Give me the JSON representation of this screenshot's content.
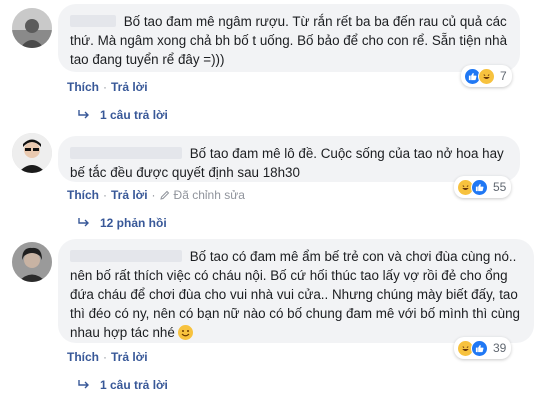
{
  "colors": {
    "link": "#385898",
    "bubble": "#f2f3f5",
    "meta": "#90949c",
    "like": "#2078f4",
    "haha": "#f7c23e"
  },
  "comments": [
    {
      "text": "Bố tao đam mê ngâm rượu. Từ rắn rết ba ba đến rau củ quả các thứ. Mà ngâm xong chả bh bố t uống. Bố bảo để cho con rể. Sẵn tiện nhà tao đang tuyển rể đây =)))",
      "reactions": [
        "like-icon",
        "haha-icon"
      ],
      "reaction_count": "7",
      "like_label": "Thích",
      "reply_label": "Trả lời",
      "separator": "·",
      "replies_label": "1 câu trả lời"
    },
    {
      "text": "Bố tao đam mê lô đề. Cuộc sống của tao nở hoa hay bế tắc đều được quyết định sau 18h30",
      "reactions": [
        "haha-icon",
        "like-icon"
      ],
      "reaction_count": "55",
      "like_label": "Thích",
      "reply_label": "Trả lời",
      "separator": "·",
      "edited_label": "Đã chỉnh sửa",
      "replies_label": "12 phản hồi"
    },
    {
      "text": "Bố tao có đam mê ẩm bế trẻ con và chơi đùa cùng nó.. nên bố rất thích việc có cháu nội. Bố cứ hối thúc tao lấy vợ rồi đẻ cho ổng đứa cháu để chơi đùa cho vui nhà vui cửa.. Nhưng chúng mày biết đấy, tao thì đéo có ny, nên có bạn nữ nào có bố chung đam mê với bố mình thì cùng nhau hợp tác nhé",
      "reactions": [
        "haha-icon",
        "like-icon"
      ],
      "reaction_count": "39",
      "like_label": "Thích",
      "reply_label": "Trả lời",
      "separator": "·",
      "replies_label": "1 câu trả lời"
    }
  ]
}
